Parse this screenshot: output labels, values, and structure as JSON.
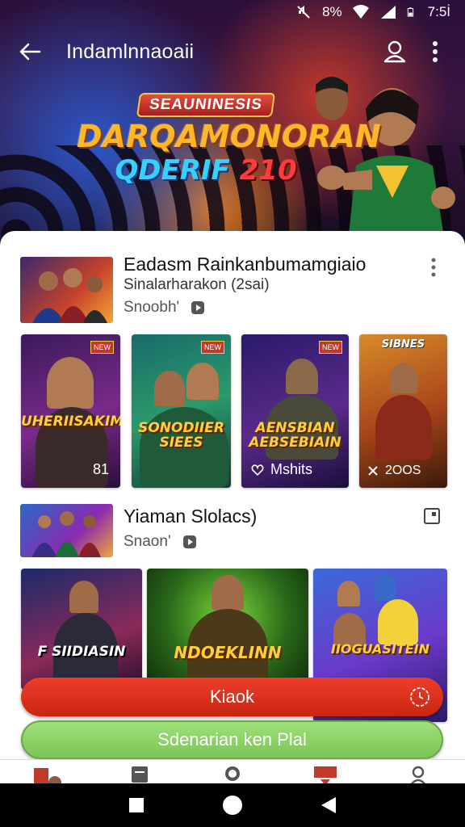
{
  "status_bar": {
    "battery": "8%",
    "time": "7:5İ"
  },
  "app_bar": {
    "title": "Indamlnnaoaii"
  },
  "hero": {
    "badge": "SEAUNINESIS",
    "line1": "DARQAMONORAN",
    "line2": "QDERIF",
    "line2_number": "210"
  },
  "section1": {
    "title": "Eadasm Rainkanbumamgiaio",
    "subtitle": "Sinalarharakon (2sai)",
    "meta": "Snoobh'",
    "cards": [
      {
        "caption": "UHERIISAKIM",
        "footer": "81",
        "flag": "NEW"
      },
      {
        "caption": "SONODIIER SIEES",
        "footer": "",
        "flag": "NEW"
      },
      {
        "caption": "AENSBIAN AEBSEBIAIN",
        "footer": "Mshits",
        "flag": "NEW"
      },
      {
        "caption": "SIBNES",
        "footer": "2OOS",
        "flag": ""
      }
    ]
  },
  "section2": {
    "title": "Yiaman Slolacs)",
    "meta": "Snaon'",
    "cards": [
      {
        "caption": "F SIIDIASIN"
      },
      {
        "caption": "NDOEKLINN"
      },
      {
        "caption": "IIOGUASITEIN"
      }
    ]
  },
  "buttons": {
    "primary": "Kiaok",
    "secondary": "Sdenarian ken Plal"
  },
  "colors": {
    "primary": "#e5341f",
    "secondary": "#8fd66a",
    "accent": "#ffb627"
  }
}
